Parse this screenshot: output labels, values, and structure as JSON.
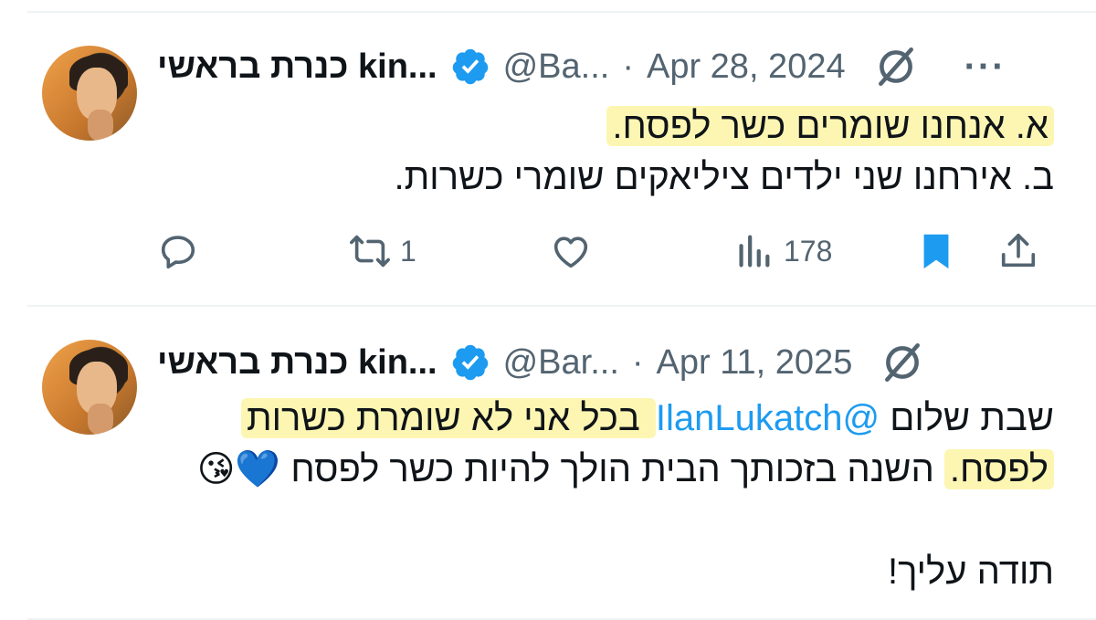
{
  "tweets": [
    {
      "name": "כנרת בראשי kin...",
      "handle": "@Ba...",
      "separator": "·",
      "date": "Apr 28, 2024",
      "more": "···",
      "lines": [
        "א. אנחנו שומרים כשר לפסח.",
        "ב. אירחנו שני ילדים ציליאקים שומרי כשרות."
      ],
      "actions": {
        "reply_count": "",
        "repost_count": "1",
        "like_count": "",
        "views_count": "178"
      }
    },
    {
      "name": "כנרת בראשי kin...",
      "handle": "@Bar...",
      "separator": "·",
      "date": "Apr 11, 2025",
      "more": "···",
      "line1_prefix": "שבת שלום ",
      "mention": "@IlanLukatch",
      "line1_highlight": " בכל אני לא שומרת כשרות",
      "line2_highlight": "לפסח.",
      "line2_rest": " השנה בזכותך הבית הולך להיות כשר לפסח ",
      "emojis": "💙😘",
      "line3": "תודה עליך!"
    }
  ],
  "colors": {
    "accent": "#1d9bf0",
    "highlight": "#fdf6b2",
    "muted": "#536471",
    "text": "#0f1419"
  }
}
